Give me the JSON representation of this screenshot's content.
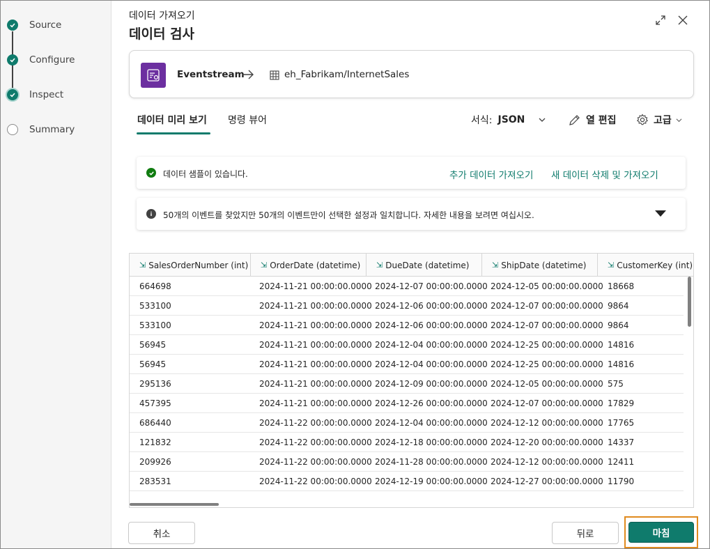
{
  "wizard": {
    "subtitle": "데이터 가져오기",
    "title": "데이터 검사",
    "expand_icon": "expand-icon",
    "close_icon": "close-icon"
  },
  "steps": [
    {
      "label": "Source",
      "state": "done"
    },
    {
      "label": "Configure",
      "state": "done"
    },
    {
      "label": "Inspect",
      "state": "done"
    },
    {
      "label": "Summary",
      "state": "pending"
    }
  ],
  "source": {
    "name": "Eventstream",
    "destination": "eh_Fabrikam/InternetSales",
    "icon_color": "#6c2fa0"
  },
  "tabs": [
    {
      "label": "데이터 미리 보기",
      "active": true
    },
    {
      "label": "명령 뷰어",
      "active": false
    }
  ],
  "toolbar": {
    "format_label": "서식:",
    "format_value": "JSON",
    "edit_columns": "열 편집",
    "advanced": "고급"
  },
  "messages": {
    "success_text": "데이터 샘플이 있습니다.",
    "get_more": "추가 데이터 가져오기",
    "discard_get_new": "새 데이터 삭제 및 가져오기",
    "info_text": "50개의 이벤트를 찾았지만 50개의 이벤트만이 선택한 설정과 일치합니다. 자세한 내용을 보려면 여십시오."
  },
  "table": {
    "columns": [
      "SalesOrderNumber (int)",
      "OrderDate (datetime)",
      "DueDate (datetime)",
      "ShipDate (datetime)",
      "CustomerKey (int)"
    ],
    "rows": [
      [
        "664698",
        "2024-11-21 00:00:00.0000",
        "2024-12-07 00:00:00.0000",
        "2024-12-05 00:00:00.0000",
        "18668"
      ],
      [
        "533100",
        "2024-11-21 00:00:00.0000",
        "2024-12-06 00:00:00.0000",
        "2024-12-07 00:00:00.0000",
        "9864"
      ],
      [
        "533100",
        "2024-11-21 00:00:00.0000",
        "2024-12-06 00:00:00.0000",
        "2024-12-07 00:00:00.0000",
        "9864"
      ],
      [
        "56945",
        "2024-11-21 00:00:00.0000",
        "2024-12-04 00:00:00.0000",
        "2024-12-25 00:00:00.0000",
        "14816"
      ],
      [
        "56945",
        "2024-11-21 00:00:00.0000",
        "2024-12-04 00:00:00.0000",
        "2024-12-25 00:00:00.0000",
        "14816"
      ],
      [
        "295136",
        "2024-11-21 00:00:00.0000",
        "2024-12-09 00:00:00.0000",
        "2024-12-05 00:00:00.0000",
        "575"
      ],
      [
        "457395",
        "2024-11-21 00:00:00.0000",
        "2024-12-26 00:00:00.0000",
        "2024-12-07 00:00:00.0000",
        "17829"
      ],
      [
        "686440",
        "2024-11-22 00:00:00.0000",
        "2024-12-04 00:00:00.0000",
        "2024-12-12 00:00:00.0000",
        "17765"
      ],
      [
        "121832",
        "2024-11-22 00:00:00.0000",
        "2024-12-18 00:00:00.0000",
        "2024-12-20 00:00:00.0000",
        "14337"
      ],
      [
        "209926",
        "2024-11-22 00:00:00.0000",
        "2024-11-28 00:00:00.0000",
        "2024-12-12 00:00:00.0000",
        "12411"
      ],
      [
        "283531",
        "2024-11-22 00:00:00.0000",
        "2024-12-19 00:00:00.0000",
        "2024-12-27 00:00:00.0000",
        "11790"
      ]
    ]
  },
  "footer": {
    "cancel": "취소",
    "back": "뒤로",
    "finish": "마침"
  },
  "colors": {
    "accent": "#0f7b6c",
    "highlight": "#e08a1e"
  }
}
